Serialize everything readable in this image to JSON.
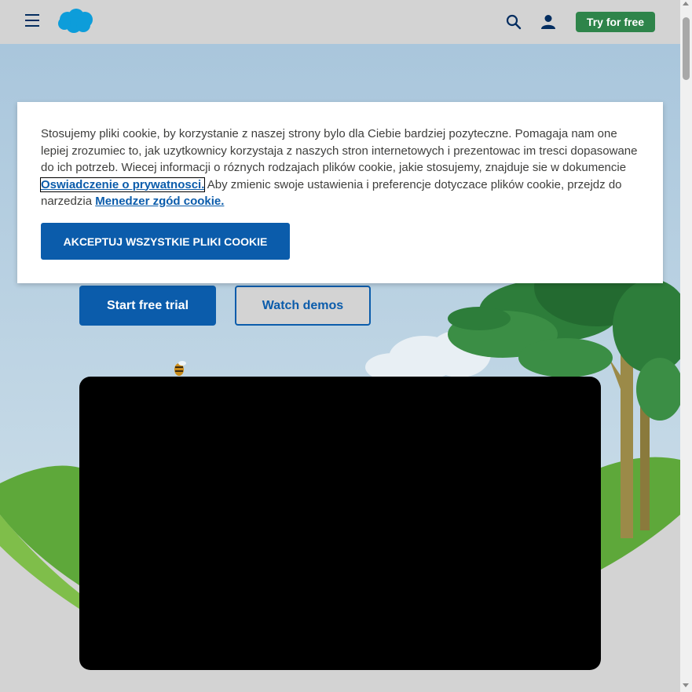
{
  "header": {
    "menu_icon": "hamburger-menu-icon",
    "logo": "salesforce-cloud-logo",
    "search_icon": "search-icon",
    "user_icon": "user-icon",
    "try_label": "Try for free"
  },
  "hero": {
    "start_label": "Start free trial",
    "demo_label": "Watch demos"
  },
  "cookie_banner": {
    "text_before": "Stosujemy pliki cookie, by korzystanie z naszej strony bylo dla Ciebie bardziej pozyteczne. Pomagaja nam one lepiej zrozumiec to, jak uzytkownicy korzystaja z naszych stron internetowych i prezentowac im tresci dopasowane do ich potrzeb. Wiecej informacji o róznych rodzajach plików cookie, jakie stosujemy, znajduje sie w dokumencie ",
    "privacy_link": "Oswiadczenie o prywatnosci.",
    "text_middle": " Aby zmienic swoje ustawienia i preferencje dotyczace plików cookie, przejdz do narzedzia ",
    "manager_link": "Menedzer zgód cookie.",
    "accept_label": "AKCEPTUJ WSZYSTKIE PLIKI COOKIE"
  },
  "colors": {
    "brand_blue": "#0b5cab",
    "navy": "#032d60",
    "try_green": "#2e844a",
    "sky": "#b8d3e6"
  }
}
